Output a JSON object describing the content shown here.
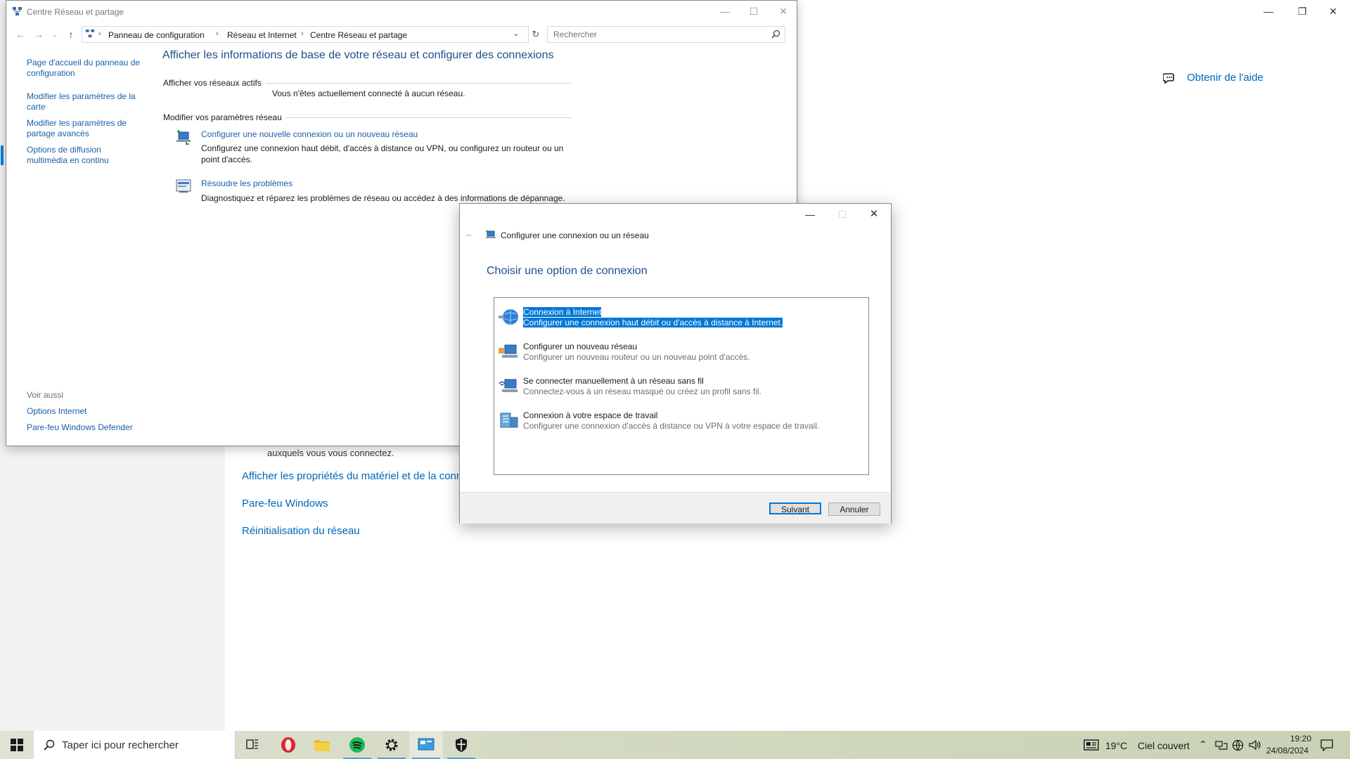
{
  "settings": {
    "help_label": "Obtenir de l'aide",
    "connect_text": "auxquels vous vous connectez.",
    "links": [
      "Afficher les propriétés du matériel et de la connexion",
      "Pare-feu Windows",
      "Réinitialisation du réseau"
    ]
  },
  "control_panel": {
    "title": "Centre Réseau et partage",
    "breadcrumb": [
      "Panneau de configuration",
      "Réseau et Internet",
      "Centre Réseau et partage"
    ],
    "search_placeholder": "Rechercher",
    "left_links": [
      "Page d'accueil du panneau de configuration",
      "Modifier les paramètres de la carte",
      "Modifier les paramètres de partage avancés",
      "Options de diffusion multimédia en continu"
    ],
    "see_also_label": "Voir aussi",
    "see_also_links": [
      "Options Internet",
      "Pare-feu Windows Defender"
    ],
    "heading": "Afficher les informations de base de votre réseau et configurer des connexions",
    "active_networks_label": "Afficher vos réseaux actifs",
    "no_network_text": "Vous n'êtes actuellement connecté à aucun réseau.",
    "change_settings_label": "Modifier vos paramètres réseau",
    "tasks": [
      {
        "link": "Configurer une nouvelle connexion ou un nouveau réseau",
        "desc": "Configurez une connexion haut débit, d'accès à distance ou VPN, ou configurez un routeur ou un point d'accès."
      },
      {
        "link": "Résoudre les problèmes",
        "desc": "Diagnostiquez et réparez les problèmes de réseau ou accédez à des informations de dépannage."
      }
    ]
  },
  "dialog": {
    "title": "Configurer une connexion ou un réseau",
    "heading": "Choisir une option de connexion",
    "options": [
      {
        "title": "Connexion à Internet",
        "desc": "Configurer une connexion haut débit ou d'accès à distance à Internet.",
        "icon": "globe-icon"
      },
      {
        "title": "Configurer un nouveau réseau",
        "desc": "Configurer un nouveau routeur ou un nouveau point d'accès.",
        "icon": "router-icon"
      },
      {
        "title": "Se connecter manuellement à un réseau sans fil",
        "desc": "Connectez-vous à un réseau masqué ou créez un profil sans fil.",
        "icon": "wireless-network-icon"
      },
      {
        "title": "Connexion à votre espace de travail",
        "desc": "Configurer une connexion d'accès à distance ou VPN à votre espace de travail.",
        "icon": "workplace-icon"
      }
    ],
    "selected_index": 0,
    "next_label": "Suivant",
    "cancel_label": "Annuler"
  },
  "taskbar": {
    "search_placeholder": "Taper ici pour rechercher",
    "weather_temp": "19°C",
    "weather_desc": "Ciel couvert",
    "time": "19:20",
    "date": "24/08/2024"
  },
  "colors": {
    "accent": "#0078d7",
    "link": "#1a5fa8",
    "heading": "#1e4e8c"
  }
}
